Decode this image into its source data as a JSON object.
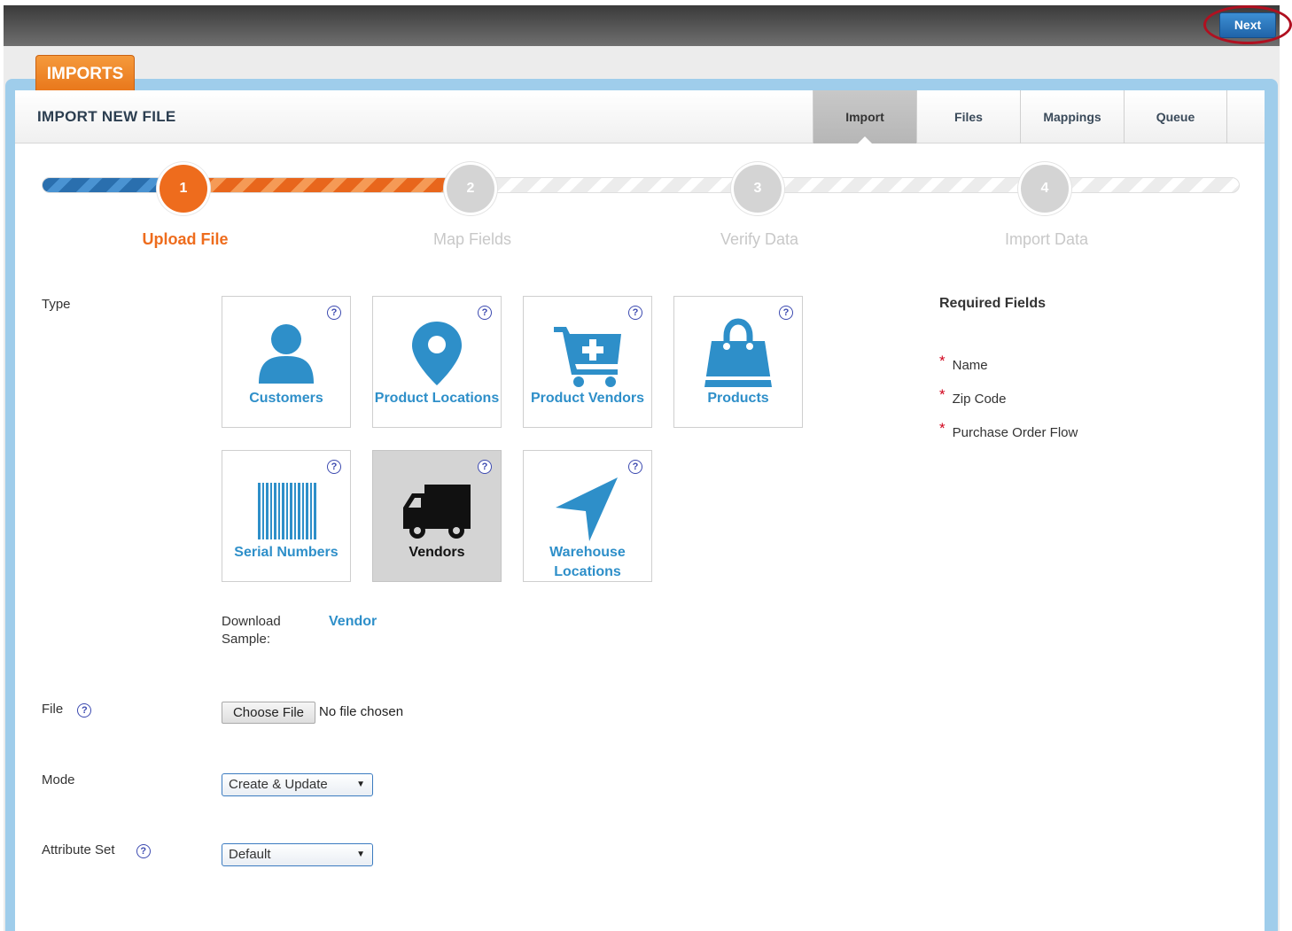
{
  "header": {
    "next_label": "Next"
  },
  "section_tab": "IMPORTS",
  "panel": {
    "title": "IMPORT NEW FILE",
    "tabs": [
      {
        "label": "Import",
        "active": true
      },
      {
        "label": "Files",
        "active": false
      },
      {
        "label": "Mappings",
        "active": false
      },
      {
        "label": "Queue",
        "active": false
      }
    ]
  },
  "steps": [
    {
      "number": "1",
      "label": "Upload File",
      "state": "current"
    },
    {
      "number": "2",
      "label": "Map Fields",
      "state": "todo"
    },
    {
      "number": "3",
      "label": "Verify Data",
      "state": "todo"
    },
    {
      "number": "4",
      "label": "Import Data",
      "state": "todo"
    }
  ],
  "form": {
    "type_label": "Type",
    "help_glyph": "?",
    "tiles": [
      {
        "label": "Customers",
        "icon": "person-icon",
        "selected": false
      },
      {
        "label": "Product Locations",
        "icon": "map-pin-icon",
        "selected": false
      },
      {
        "label": "Product Vendors",
        "icon": "cart-plus-icon",
        "selected": false
      },
      {
        "label": "Products",
        "icon": "shopping-bag-icon",
        "selected": false
      },
      {
        "label": "Serial Numbers",
        "icon": "barcode-icon",
        "selected": false
      },
      {
        "label": "Vendors",
        "icon": "truck-icon",
        "selected": true
      },
      {
        "label": "Warehouse Locations",
        "icon": "location-arrow-icon",
        "selected": false
      }
    ],
    "download_label": "Download Sample:",
    "download_link": "Vendor",
    "file_label": "File",
    "choose_file": "Choose File",
    "no_file": "No file chosen",
    "mode_label": "Mode",
    "mode_value": "Create & Update",
    "attribute_set_label": "Attribute Set",
    "attribute_set_value": "Default"
  },
  "required": {
    "title": "Required Fields",
    "items": [
      "Name",
      "Zip Code",
      "Purchase Order Flow"
    ]
  },
  "colors": {
    "accent": "#ee6c1d",
    "link": "#2e8fc9",
    "primary": "#1f63a8",
    "required": "#d0021b"
  }
}
